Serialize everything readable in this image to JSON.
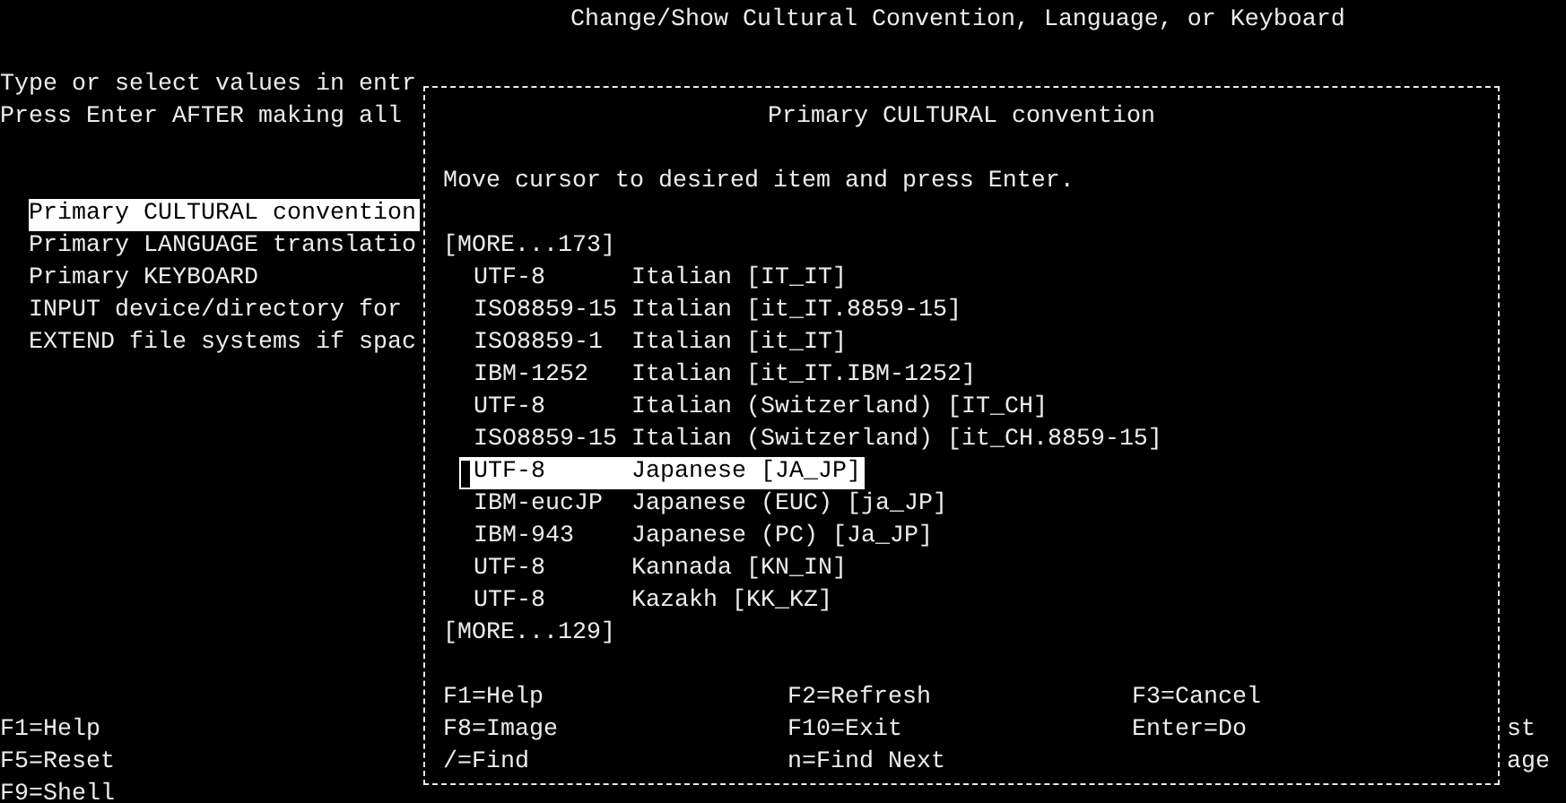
{
  "window": {
    "title": "Change/Show Cultural Convention, Language, or Keyboard"
  },
  "instructions": [
    "Type or select values in entr",
    "Press Enter AFTER making all"
  ],
  "fields": [
    {
      "label": "Primary CULTURAL convention",
      "selected": true
    },
    {
      "label": "Primary LANGUAGE translatio",
      "selected": false
    },
    {
      "label": "Primary KEYBOARD",
      "selected": false
    },
    {
      "label": "INPUT device/directory for",
      "selected": false
    },
    {
      "label": "EXTEND file systems if spac",
      "selected": false
    }
  ],
  "function_keys": [
    "F1=Help",
    "F5=Reset",
    "F9=Shell"
  ],
  "right_edge": [
    "st",
    "age"
  ],
  "popup": {
    "title": "Primary CULTURAL convention",
    "instruction": "Move cursor to desired item and press Enter.",
    "more_above": "[MORE...173]",
    "items": [
      {
        "codeset": "UTF-8",
        "name": "Italian [IT_IT]",
        "selected": false
      },
      {
        "codeset": "ISO8859-15",
        "name": "Italian [it_IT.8859-15]",
        "selected": false
      },
      {
        "codeset": "ISO8859-1",
        "name": "Italian [it_IT]",
        "selected": false
      },
      {
        "codeset": "IBM-1252",
        "name": "Italian [it_IT.IBM-1252]",
        "selected": false
      },
      {
        "codeset": "UTF-8",
        "name": "Italian (Switzerland) [IT_CH]",
        "selected": false
      },
      {
        "codeset": "ISO8859-15",
        "name": "Italian (Switzerland) [it_CH.8859-15]",
        "selected": false
      },
      {
        "codeset": "UTF-8",
        "name": "Japanese [JA_JP]",
        "selected": true
      },
      {
        "codeset": "IBM-eucJP",
        "name": "Japanese (EUC) [ja_JP]",
        "selected": false
      },
      {
        "codeset": "IBM-943",
        "name": "Japanese (PC) [Ja_JP]",
        "selected": false
      },
      {
        "codeset": "UTF-8",
        "name": "Kannada [KN_IN]",
        "selected": false
      },
      {
        "codeset": "UTF-8",
        "name": "Kazakh [KK_KZ]",
        "selected": false
      }
    ],
    "more_below": "[MORE...129]",
    "function_keys": [
      [
        "F1=Help",
        "F2=Refresh",
        "F3=Cancel"
      ],
      [
        "F8=Image",
        "F10=Exit",
        "Enter=Do"
      ],
      [
        "/=Find",
        "n=Find Next"
      ]
    ]
  }
}
